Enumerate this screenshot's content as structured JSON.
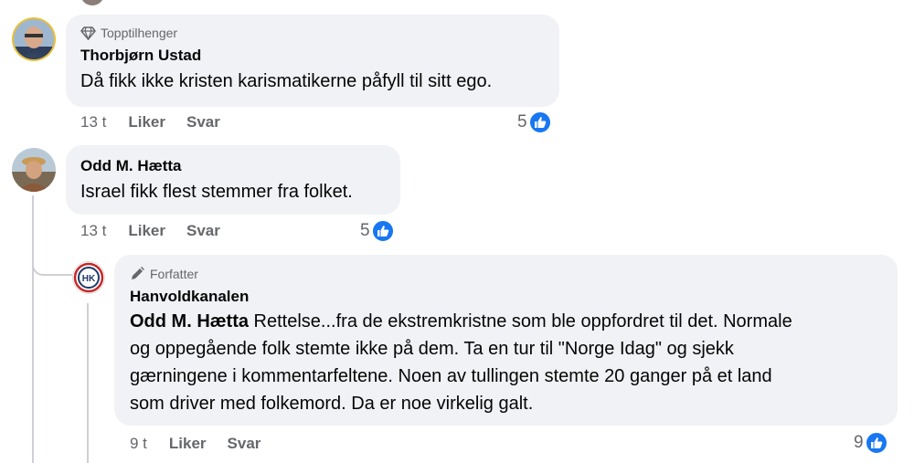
{
  "comments": [
    {
      "badge": "Topptilhenger",
      "badge_icon": "diamond-icon",
      "author": "Thorbjørn Ustad",
      "text": "Då fikk ikke kristen karismatikerne påfyll til sitt ego.",
      "time": "13 t",
      "like_label": "Liker",
      "reply_label": "Svar",
      "reaction_count": "5",
      "reaction_icon": "thumbs-up-icon"
    },
    {
      "author": "Odd M. Hætta",
      "text": "Israel fikk flest stemmer fra folket.",
      "time": "13 t",
      "like_label": "Liker",
      "reply_label": "Svar",
      "reaction_count": "5",
      "reaction_icon": "thumbs-up-icon"
    },
    {
      "badge": "Forfatter",
      "badge_icon": "pen-icon",
      "author": "Hanvoldkanalen",
      "avatar_text": "HK",
      "mention": "Odd M. Hætta",
      "text_lines": [
        " Rettelse...fra de ekstremkristne som ble oppfordret til det. Normale",
        "og oppegående folk stemte ikke på dem. Ta en tur til \"Norge Idag\" og sjekk",
        "gærningene i kommentarfeltene. Noen av tullingen stemte 20 ganger på et land",
        "som driver med folkemord. Da er noe virkelig galt."
      ],
      "time": "9 t",
      "like_label": "Liker",
      "reply_label": "Svar",
      "reaction_count": "9",
      "reaction_icon": "thumbs-up-icon"
    }
  ],
  "colors": {
    "bubble": "#f0f2f5",
    "meta_text": "#65676b",
    "like_blue": "#1877f2",
    "thread_line": "#ced0d4",
    "hk_red": "#c62828",
    "hk_navy": "#1f3a68"
  }
}
